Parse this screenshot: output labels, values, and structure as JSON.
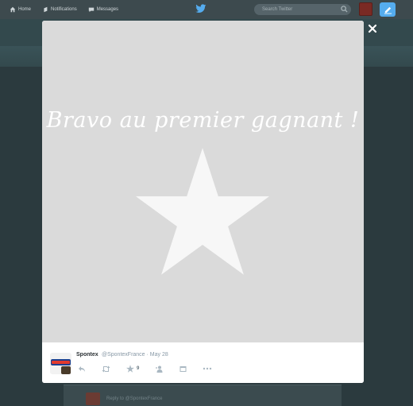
{
  "nav": {
    "home": "Home",
    "notifications": "Notifications",
    "messages": "Messages",
    "search_placeholder": "Search Twitter"
  },
  "modal": {
    "media_text": "Bravo au premier gagnant !",
    "tweet": {
      "name": "Spontex",
      "handle_date": "@SpontexFrance · May 28",
      "favorite_count": "9"
    }
  },
  "background": {
    "reply_text": "Reply to @SpontexFrance"
  },
  "colors": {
    "accent": "#55acee",
    "media_bg": "#dadada"
  }
}
